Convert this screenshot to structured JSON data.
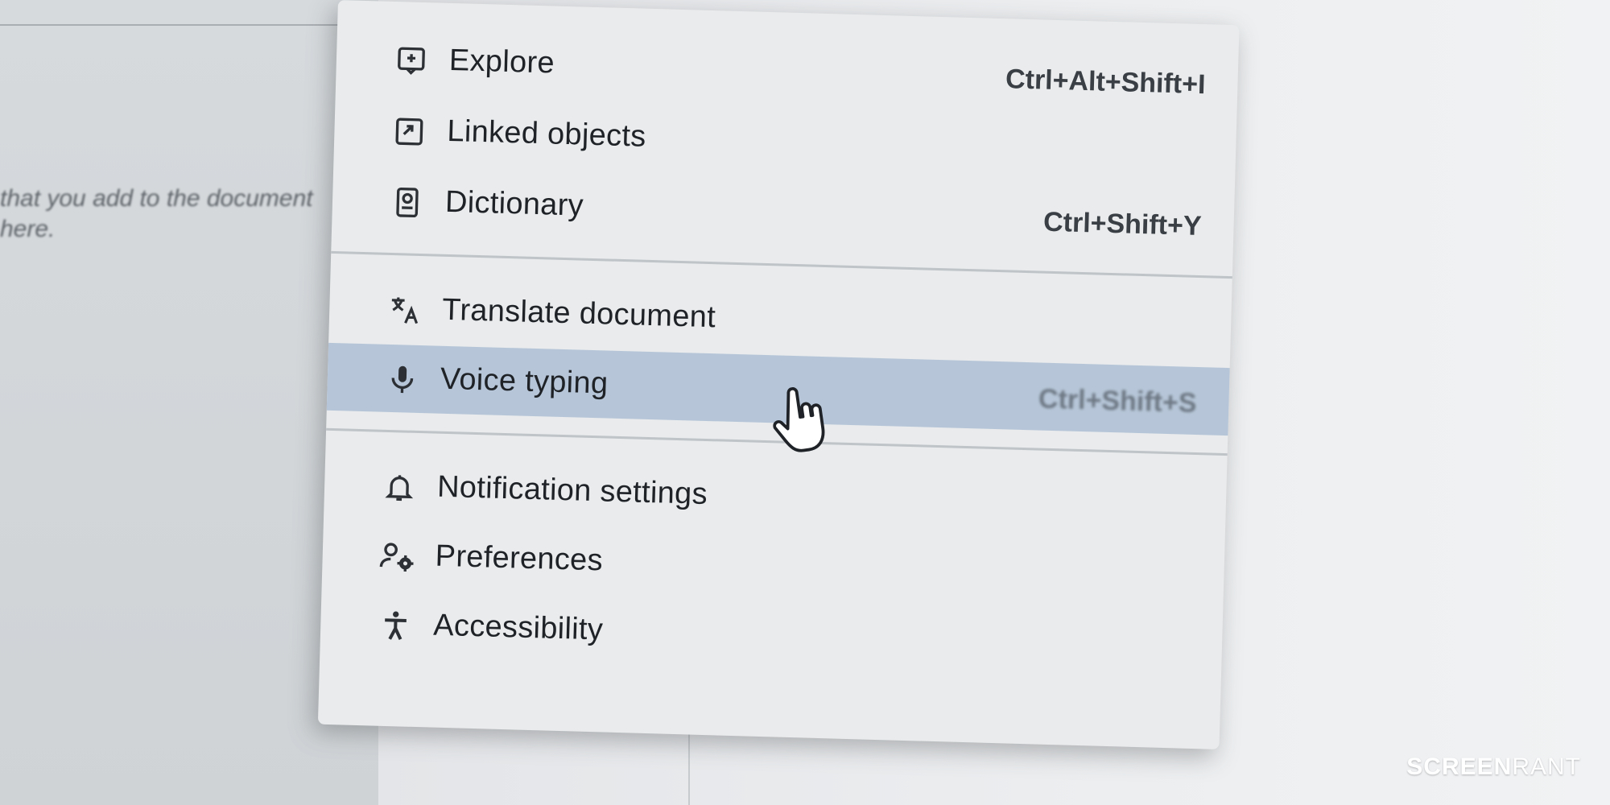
{
  "document": {
    "hint_line1": "that you add to the document",
    "hint_line2": "here."
  },
  "menu": {
    "items": [
      {
        "label": "Explore",
        "icon": "explore-icon",
        "shortcut": "Ctrl+Alt+Shift+I"
      },
      {
        "label": "Linked objects",
        "icon": "linked-objects-icon",
        "shortcut": ""
      },
      {
        "label": "Dictionary",
        "icon": "dictionary-icon",
        "shortcut": "Ctrl+Shift+Y"
      },
      {
        "label": "Translate document",
        "icon": "translate-icon",
        "shortcut": ""
      },
      {
        "label": "Voice typing",
        "icon": "microphone-icon",
        "shortcut": "Ctrl+Shift+S",
        "active": true
      },
      {
        "label": "Notification settings",
        "icon": "bell-icon",
        "shortcut": ""
      },
      {
        "label": "Preferences",
        "icon": "preferences-icon",
        "shortcut": ""
      },
      {
        "label": "Accessibility",
        "icon": "accessibility-icon",
        "shortcut": ""
      }
    ],
    "highlight_color": "#b6c6d8"
  },
  "watermark": {
    "part1": "SCREEN",
    "part2": "RANT"
  }
}
